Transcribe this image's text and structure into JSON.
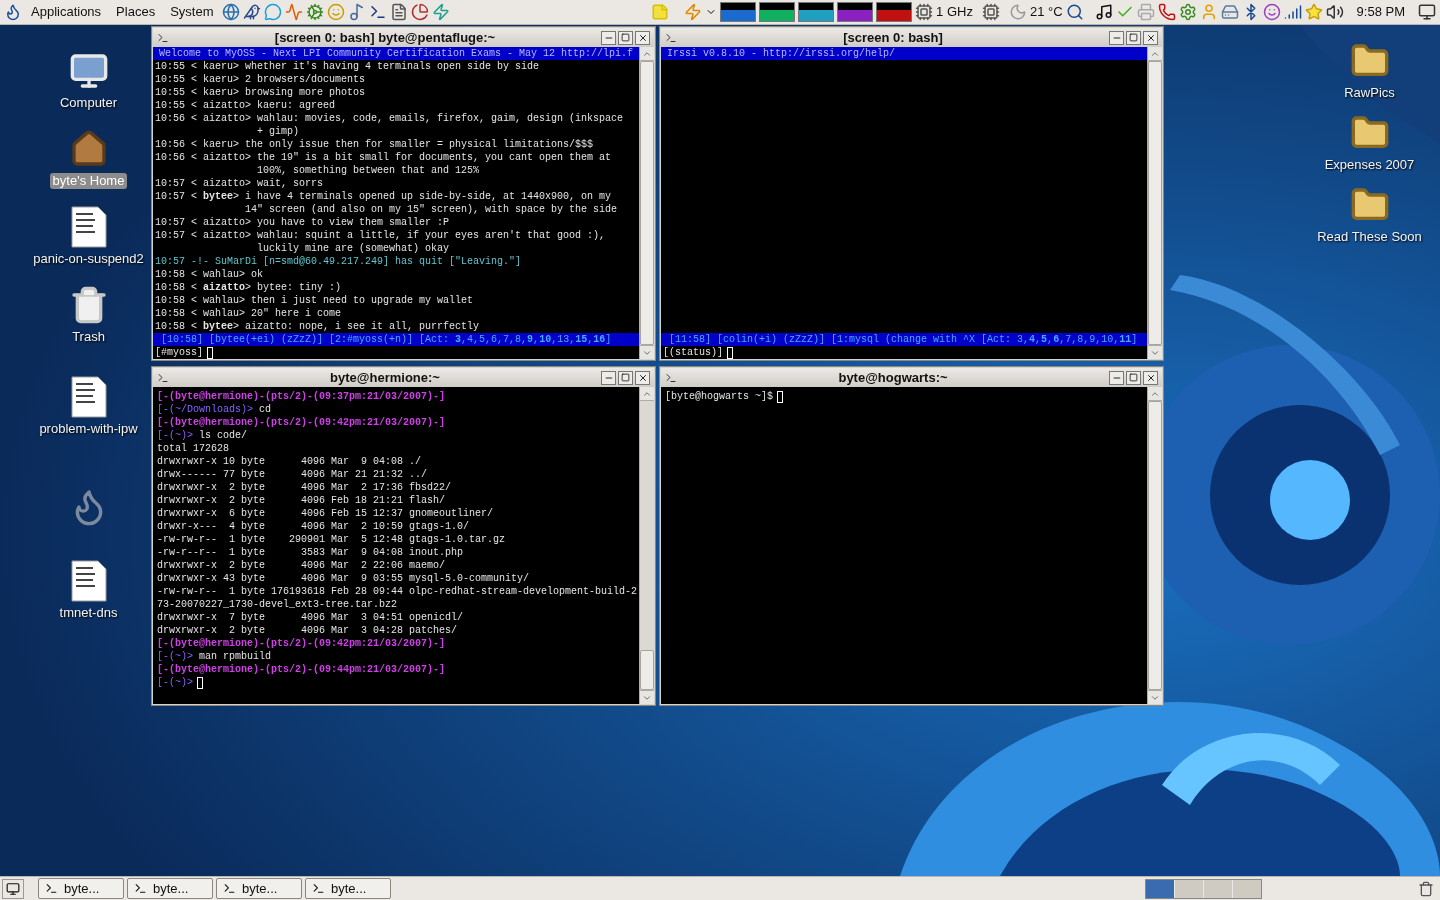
{
  "top_panel": {
    "menus": [
      {
        "label": "Applications"
      },
      {
        "label": "Places"
      },
      {
        "label": "System"
      }
    ],
    "cpu_freq": "1 GHz",
    "temperature": "21 °C",
    "clock": "9:58 PM"
  },
  "desktop_left": [
    {
      "label": "Computer",
      "kind": "computer",
      "selected": false
    },
    {
      "label": "byte's Home",
      "kind": "home",
      "selected": true
    },
    {
      "label": "panic-on-suspend2",
      "kind": "document",
      "selected": false
    },
    {
      "label": "Trash",
      "kind": "trash",
      "selected": false
    },
    {
      "label": "problem-with-ipw",
      "kind": "document",
      "selected": false
    },
    {
      "kind": "logo"
    },
    {
      "label": "tmnet-dns",
      "kind": "document",
      "selected": false
    }
  ],
  "desktop_right": [
    {
      "label": "RawPics",
      "kind": "folder",
      "selected": false
    },
    {
      "label": "Expenses 2007",
      "kind": "folder",
      "selected": false
    },
    {
      "label": "Read These Soon",
      "kind": "folder",
      "selected": false
    }
  ],
  "windows": [
    {
      "kind": "irssi",
      "title": "[screen 0: bash] byte@pentafluge:~",
      "topic": "Welcome to MyOSS - Next LPI Community Certification Exams - May 12 http://lpi.f",
      "lines": [
        {
          "kind": "msg",
          "text": "10:55 < kaeru> whether it's having 4 terminals open side by side"
        },
        {
          "kind": "msg",
          "text": "10:55 < kaeru> 2 browsers/documents"
        },
        {
          "kind": "msg",
          "text": "10:55 < kaeru> browsing more photos"
        },
        {
          "kind": "msg",
          "text": "10:55 < aizatto> kaeru: agreed"
        },
        {
          "kind": "msg",
          "text": "10:56 < aizatto> wahlau: movies, code, emails, firefox, gaim, design (inkspace"
        },
        {
          "kind": "msg",
          "text": "                 + gimp)"
        },
        {
          "kind": "msg",
          "text": "10:56 < kaeru> the only issue then for smaller = physical limitations/$$$"
        },
        {
          "kind": "msg",
          "text": "10:56 < aizatto> the 19\" is a bit small for documents, you cant open them at"
        },
        {
          "kind": "msg",
          "text": "                 100%, something between that and 125%"
        },
        {
          "kind": "msg",
          "text": "10:57 < aizatto> wait, sorrs"
        },
        {
          "kind": "msg",
          "text": "10:57 < **bytee**> i have 4 terminals opened up side-by-side, at 1440x900, on my"
        },
        {
          "kind": "msg",
          "text": "               14\" screen (and also on my 15\" screen), with space by the side"
        },
        {
          "kind": "msg",
          "text": "10:57 < aizatto> you have to view them smaller :P"
        },
        {
          "kind": "msg",
          "text": "10:57 < aizatto> wahlau: squint a little, if your eyes aren't that good :),"
        },
        {
          "kind": "msg",
          "text": "                 luckily mine are (somewhat) okay"
        },
        {
          "kind": "quit",
          "text": "10:57 -!- SuMarDi [n=smd@60.49.217.249] has quit [\"Leaving.\"]"
        },
        {
          "kind": "msg",
          "text": "10:58 < wahlau> ok"
        },
        {
          "kind": "highlight",
          "text": "10:58 < **aizatto**> bytee: tiny :)"
        },
        {
          "kind": "msg",
          "text": "10:58 < wahlau> then i just need to upgrade my wallet"
        },
        {
          "kind": "msg",
          "text": "10:58 < wahlau> 20\" here i come"
        },
        {
          "kind": "msg",
          "text": "10:58 < **bytee**> aizatto: nope, i see it all, purrfectly"
        }
      ],
      "status": " [10:58] [bytee(+ei) (zZzZ)] [2:#myoss(+n)] [Act: **3**,4,5,6,7,8,**9**,**10**,13,**15**,**16**]",
      "input": "[#myoss]"
    },
    {
      "kind": "irssi",
      "title": "[screen 0: bash]",
      "topic": "Irssi v0.8.10 - http://irssi.org/help/",
      "status": " [11:58] [colin(+i) (zZzZ)] [1:mysql (change with ^X [Act: 3,**4**,**5**,**6**,7,8,9,10,**11**]",
      "input": "[(status)]"
    },
    {
      "kind": "shell",
      "title": "byte@hermione:~",
      "lines": [
        {
          "kind": "info",
          "text": "[-(byte@hermione)-(pts/2)-(09:37pm:21/03/2007)-]"
        },
        {
          "kind": "prompt",
          "prompt": "[-(~/Downloads)>",
          "cmd": "cd"
        },
        {
          "kind": "info",
          "text": "[-(byte@hermione)-(pts/2)-(09:42pm:21/03/2007)-]"
        },
        {
          "kind": "prompt",
          "prompt": "[-(~)>",
          "cmd": "ls code/"
        },
        {
          "kind": "out",
          "text": "total 172628"
        },
        {
          "kind": "out",
          "text": "drwxrwxr-x 10 byte      4096 Mar  9 04:08 ./"
        },
        {
          "kind": "out",
          "text": "drwx------ 77 byte      4096 Mar 21 21:32 ../"
        },
        {
          "kind": "out",
          "text": "drwxrwxr-x  2 byte      4096 Mar  2 17:36 fbsd22/"
        },
        {
          "kind": "out",
          "text": "drwxrwxr-x  2 byte      4096 Feb 18 21:21 flash/"
        },
        {
          "kind": "out",
          "text": "drwxrwxr-x  6 byte      4096 Feb 15 12:37 gnomeoutliner/"
        },
        {
          "kind": "out",
          "text": "drwxr-x---  4 byte      4096 Mar  2 10:59 gtags-1.0/"
        },
        {
          "kind": "out",
          "text": "-rw-rw-r--  1 byte    290901 Mar  5 12:48 gtags-1.0.tar.gz"
        },
        {
          "kind": "out",
          "text": "-rw-r--r--  1 byte      3583 Mar  9 04:08 inout.php"
        },
        {
          "kind": "out",
          "text": "drwxrwxr-x  2 byte      4096 Mar  2 22:06 maemo/"
        },
        {
          "kind": "out",
          "text": "drwxrwxr-x 43 byte      4096 Mar  9 03:55 mysql-5.0-community/"
        },
        {
          "kind": "out",
          "text": "-rw-rw-r--  1 byte 176193618 Feb 28 09:44 olpc-redhat-stream-development-build-2"
        },
        {
          "kind": "out",
          "text": "73-20070227_1730-devel_ext3-tree.tar.bz2"
        },
        {
          "kind": "out",
          "text": "drwxrwxr-x  7 byte      4096 Mar  3 04:51 openicdl/"
        },
        {
          "kind": "out",
          "text": "drwxrwxr-x  2 byte      4096 Mar  3 04:28 patches/"
        },
        {
          "kind": "info",
          "text": "[-(byte@hermione)-(pts/2)-(09:42pm:21/03/2007)-]"
        },
        {
          "kind": "prompt",
          "prompt": "[-(~)>",
          "cmd": "man rpmbuild"
        },
        {
          "kind": "info",
          "text": "[-(byte@hermione)-(pts/2)-(09:44pm:21/03/2007)-]"
        },
        {
          "kind": "prompt",
          "prompt": "[-(~)>"
        }
      ]
    },
    {
      "kind": "shell",
      "title": "byte@hogwarts:~",
      "lines": [
        {
          "kind": "out",
          "text": "[byte@hogwarts ~]$"
        }
      ]
    }
  ],
  "taskbar": {
    "buttons": [
      {
        "label": "byte...",
        "selected": false
      },
      {
        "label": "byte...",
        "selected": false
      },
      {
        "label": "byte...",
        "selected": false
      },
      {
        "label": "byte...",
        "selected": false
      }
    ]
  }
}
